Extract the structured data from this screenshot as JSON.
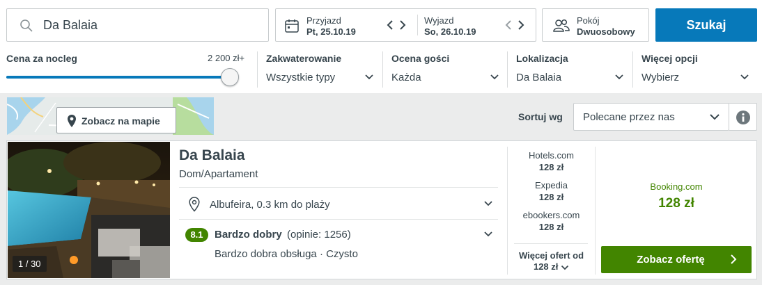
{
  "search": {
    "destination": "Da Balaia",
    "checkin_label": "Przyjazd",
    "checkin_value": "Pt, 25.10.19",
    "checkout_label": "Wyjazd",
    "checkout_value": "So, 26.10.19",
    "room_label": "Pokój",
    "room_value": "Dwuosobowy",
    "search_button": "Szukaj",
    "icons": [
      "search-icon",
      "calendar-icon",
      "chevron-left-icon",
      "chevron-right-icon",
      "people-icon"
    ]
  },
  "filters": {
    "price": {
      "title": "Cena za nocleg",
      "max_label": "2 200 zł+",
      "slider_level_percent": 100
    },
    "accommodation": {
      "title": "Zakwaterowanie",
      "value": "Wszystkie typy"
    },
    "rating": {
      "title": "Ocena gości",
      "value": "Każda"
    },
    "location": {
      "title": "Lokalizacja",
      "value": "Da Balaia"
    },
    "more": {
      "title": "Więcej opcji",
      "value": "Wybierz"
    }
  },
  "toolbar": {
    "map_button": "Zobacz na mapie",
    "sort_label": "Sortuj wg",
    "sort_value": "Polecane przez nas"
  },
  "hotel": {
    "name": "Da Balaia",
    "type": "Dom/Apartament",
    "photo_counter": "1 / 30",
    "location": "Albufeira, 0.3 km do plaży",
    "rating_score": "8.1",
    "rating_word": "Bardzo dobry",
    "rating_count": "(opinie: 1256)",
    "rating_tags": "Bardzo dobra obsługa · Czysto",
    "deals": [
      {
        "provider": "Hotels.com",
        "price": "128 zł"
      },
      {
        "provider": "Expedia",
        "price": "128 zł"
      },
      {
        "provider": "ebookers.com",
        "price": "128 zł"
      }
    ],
    "more_offers_label": "Więcej ofert od",
    "more_offers_price": "128 zł",
    "best_provider": "Booking.com",
    "best_price": "128 zł",
    "offer_button": "Zobacz ofertę"
  },
  "colors": {
    "primary_blue": "#0779ba",
    "deal_green": "#428500",
    "text": "#37454d",
    "background_gray": "#ebecec"
  }
}
